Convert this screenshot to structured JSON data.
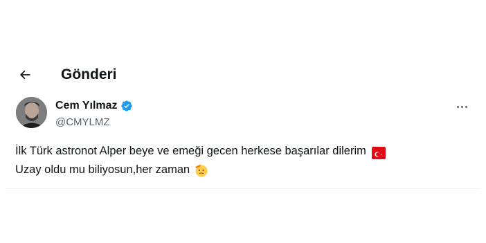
{
  "header": {
    "back_icon": "arrow-left-icon",
    "title": "Gönderi"
  },
  "post": {
    "author": {
      "display_name": "Cem Yılmaz",
      "handle": "@CMYLMZ",
      "verified_icon": "verified-badge-icon",
      "verified_color": "#1d9bf0"
    },
    "more_icon": "more-horizontal-icon",
    "text_lines": [
      "İlk Türk astronot Alper beye  ve emeği gecen herkese başarılar dilerim",
      "Uzay oldu mu biliyosun,her zaman"
    ],
    "emojis": [
      "turkey-flag-icon",
      "saluting-face-icon"
    ]
  },
  "colors": {
    "text": "#0f1419",
    "secondary": "#536471",
    "divider": "#eff3f4",
    "accent": "#1d9bf0"
  }
}
